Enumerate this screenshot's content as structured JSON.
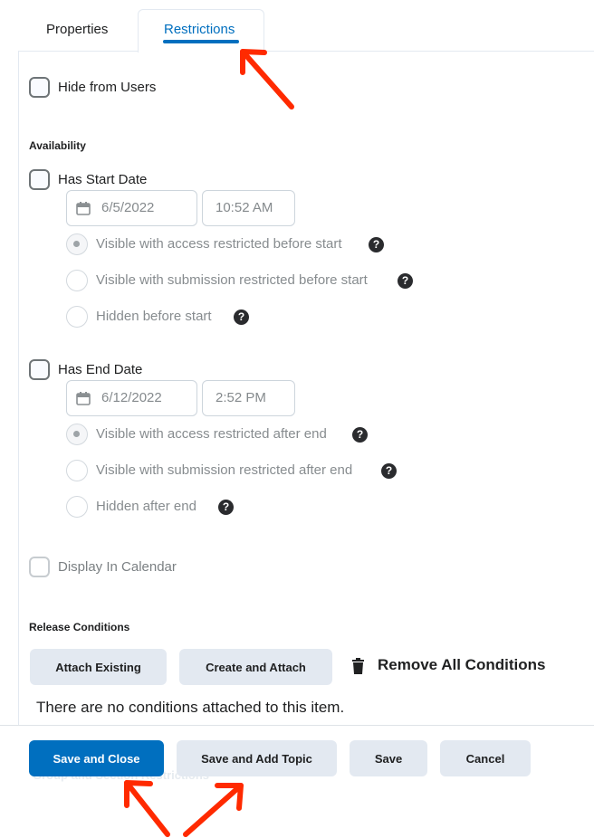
{
  "tabs": {
    "properties": "Properties",
    "restrictions": "Restrictions"
  },
  "hide_from_users": {
    "label": "Hide from Users",
    "checked": false
  },
  "availability": {
    "heading": "Availability",
    "start": {
      "label": "Has Start Date",
      "date": "6/5/2022",
      "time": "10:52 AM",
      "options": [
        {
          "label": "Visible with access restricted before start",
          "selected": true
        },
        {
          "label": "Visible with submission restricted before start",
          "selected": false
        },
        {
          "label": "Hidden before start",
          "selected": false
        }
      ]
    },
    "end": {
      "label": "Has End Date",
      "date": "6/12/2022",
      "time": "2:52 PM",
      "options": [
        {
          "label": "Visible with access restricted after end",
          "selected": true
        },
        {
          "label": "Visible with submission restricted after end",
          "selected": false
        },
        {
          "label": "Hidden after end",
          "selected": false
        }
      ]
    },
    "display_in_calendar": "Display In Calendar"
  },
  "release_conditions": {
    "heading": "Release Conditions",
    "attach_existing": "Attach Existing",
    "create_and_attach": "Create and Attach",
    "remove_all": "Remove All Conditions",
    "empty_note": "There are no conditions attached to this item.",
    "obscured_next_heading": "Group and Section Restrictions"
  },
  "footer": {
    "save_and_close": "Save and Close",
    "save_and_add_topic": "Save and Add Topic",
    "save": "Save",
    "cancel": "Cancel"
  },
  "help_glyph": "?",
  "colors": {
    "accent": "#006fbf",
    "annotation_arrow": "#ff2a00",
    "button_bg": "#e3e9f1"
  },
  "icons": [
    "calendar-icon",
    "help-icon",
    "trash-icon",
    "annotation-arrow"
  ]
}
